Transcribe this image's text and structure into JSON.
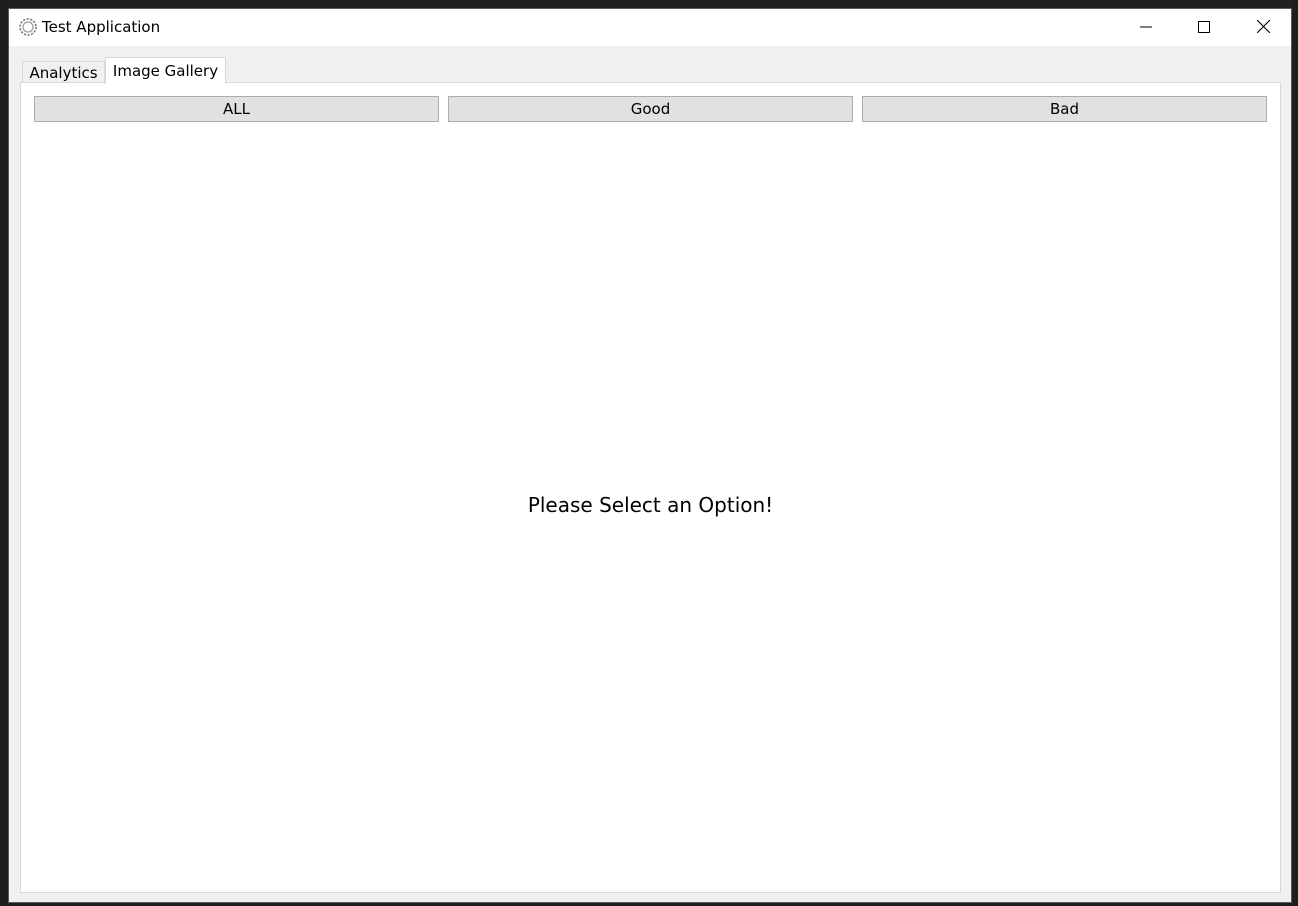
{
  "window": {
    "title": "Test Application"
  },
  "tabs": [
    {
      "label": "Analytics",
      "active": false
    },
    {
      "label": "Image Gallery",
      "active": true
    }
  ],
  "filters": {
    "all_label": "ALL",
    "good_label": "Good",
    "bad_label": "Bad"
  },
  "gallery": {
    "prompt": "Please Select an Option!"
  },
  "icons": {
    "app": "gear-icon",
    "minimize": "minimize-icon",
    "maximize": "maximize-icon",
    "close": "close-icon"
  },
  "colors": {
    "titlebar": "#ffffff",
    "window_bg": "#f0f0f0",
    "button_bg": "#e1e1e1",
    "button_border": "#adadad",
    "panel_bg": "#ffffff"
  }
}
